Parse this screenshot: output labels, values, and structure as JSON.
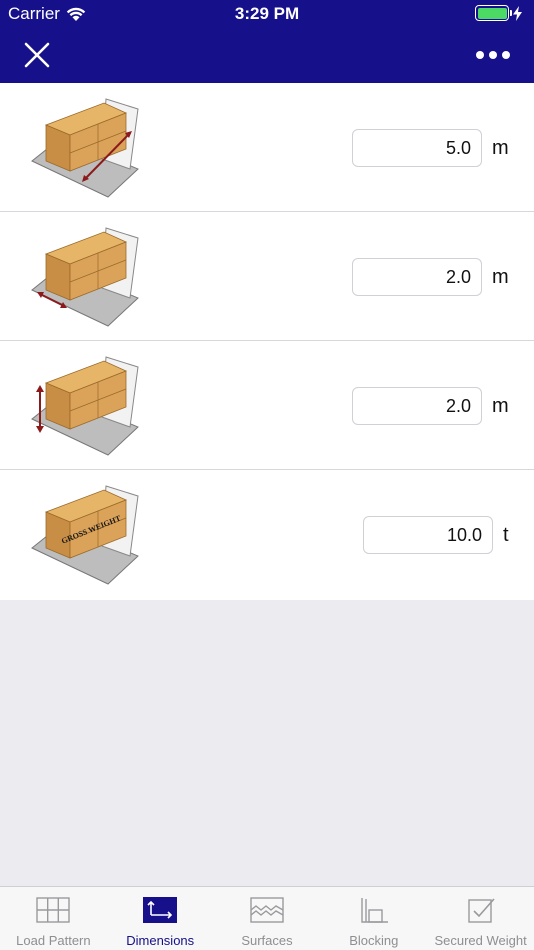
{
  "status_bar": {
    "carrier": "Carrier",
    "time": "3:29 PM"
  },
  "nav": {
    "close_icon": "close-icon",
    "more_icon": "ellipsis-icon"
  },
  "rows": [
    {
      "name": "length",
      "value": "5.0",
      "unit": "m",
      "icon": "length-illustration"
    },
    {
      "name": "width",
      "value": "2.0",
      "unit": "m",
      "icon": "width-illustration"
    },
    {
      "name": "height",
      "value": "2.0",
      "unit": "m",
      "icon": "height-illustration"
    },
    {
      "name": "gross-weight",
      "value": "10.0",
      "unit": "t",
      "icon": "gross-weight-illustration",
      "stamp": "GROSS WEIGHT"
    }
  ],
  "tabs": [
    {
      "label": "Load Pattern",
      "icon": "grid-icon",
      "active": false
    },
    {
      "label": "Dimensions",
      "icon": "dimensions-icon",
      "active": true
    },
    {
      "label": "Surfaces",
      "icon": "surfaces-icon",
      "active": false
    },
    {
      "label": "Blocking",
      "icon": "blocking-icon",
      "active": false
    },
    {
      "label": "Secured Weight",
      "icon": "secured-weight-icon",
      "active": false
    }
  ],
  "colors": {
    "nav_bg": "#16108a",
    "active_tab": "#16108a",
    "inactive_tab": "#8e8e93",
    "battery": "#4cd964",
    "arrow": "#8b1a1a",
    "cargo": "#d9a55a"
  }
}
